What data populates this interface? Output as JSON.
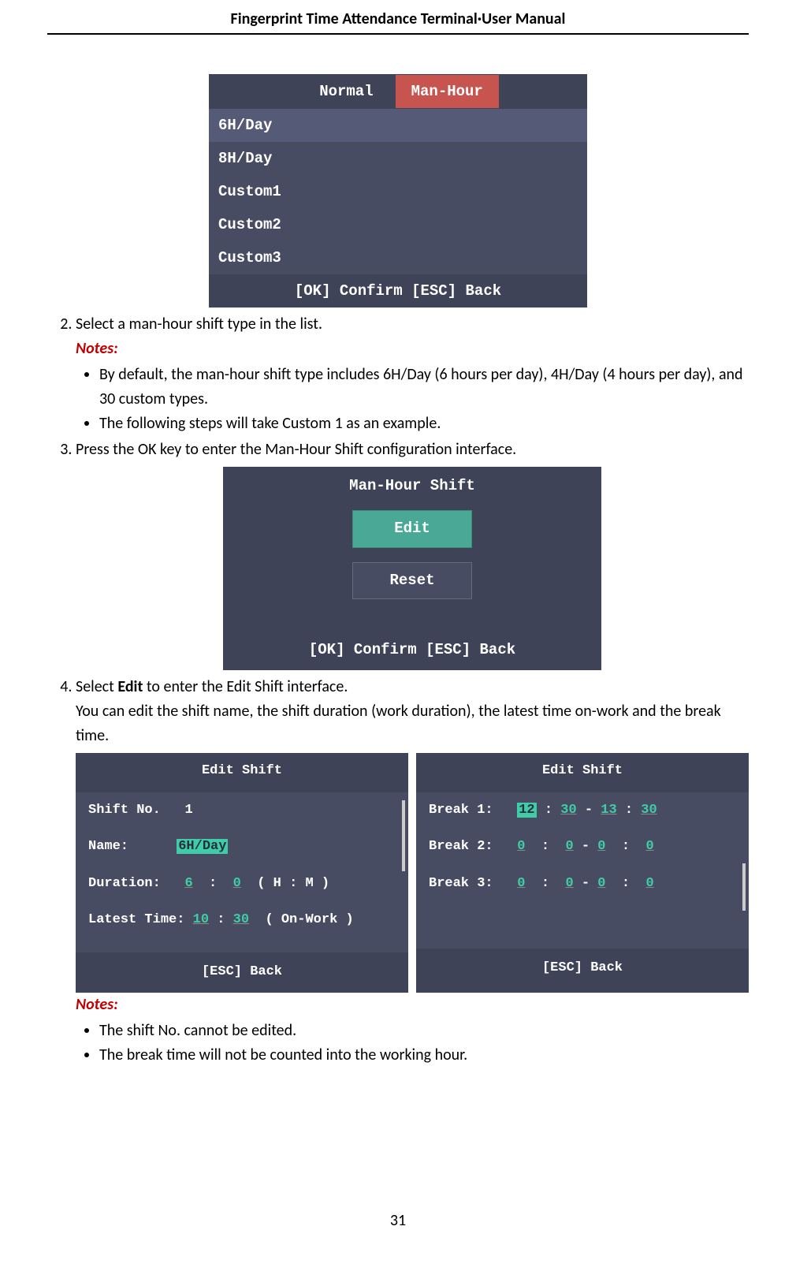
{
  "doc": {
    "header": "Fingerprint Time Attendance Terminal·User Manual",
    "page": "31"
  },
  "ui1": {
    "tab_normal": "Normal",
    "tab_manhour": "Man-Hour",
    "item1": "6H/Day",
    "item2": "8H/Day",
    "item3": "Custom1",
    "item4": "Custom2",
    "item5": "Custom3",
    "footer": "[OK] Confirm   [ESC] Back"
  },
  "step2": {
    "text": "Select a man-hour shift type in the list.",
    "notes_label": "Notes:",
    "bullet1": "By default, the man-hour shift type includes 6H/Day (6 hours per day), 4H/Day (4 hours per day), and 30 custom types.",
    "bullet2": "The following steps will take Custom 1 as an example."
  },
  "step3": {
    "text": "Press the OK key to enter the Man-Hour Shift configuration interface."
  },
  "ui2": {
    "title": "Man-Hour Shift",
    "btn_edit": "Edit",
    "btn_reset": "Reset",
    "footer": "[OK] Confirm   [ESC] Back"
  },
  "step4": {
    "pre": "Select ",
    "bold": "Edit",
    "post": " to enter the Edit Shift interface.",
    "line2": "You can edit the shift name, the shift duration (work duration), the latest time on-work and the break time."
  },
  "edit1": {
    "title": "Edit Shift",
    "shift_no_label": "Shift No.",
    "shift_no_val": "1",
    "name_label": "Name:",
    "name_val": "6H/Day",
    "duration_label": "Duration:",
    "dur_h": "6",
    "dur_m": "0",
    "dur_suffix": "( H : M )",
    "latest_label": "Latest Time:",
    "lat_h": "10",
    "lat_m": "30",
    "lat_suffix": "( On-Work )",
    "footer": "[ESC] Back"
  },
  "edit2": {
    "title": "Edit Shift",
    "b1_label": "Break 1:",
    "b1_sh": "12",
    "b1_sm": "30",
    "b1_eh": "13",
    "b1_em": "30",
    "b2_label": "Break 2:",
    "b2_sh": "0",
    "b2_sm": "0",
    "b2_eh": "0",
    "b2_em": "0",
    "b3_label": "Break 3:",
    "b3_sh": "0",
    "b3_sm": "0",
    "b3_eh": "0",
    "b3_em": "0",
    "footer": "[ESC] Back"
  },
  "notes2": {
    "label": "Notes:",
    "b1": "The shift No. cannot be edited.",
    "b2": "The break time will not be counted into the working hour."
  }
}
